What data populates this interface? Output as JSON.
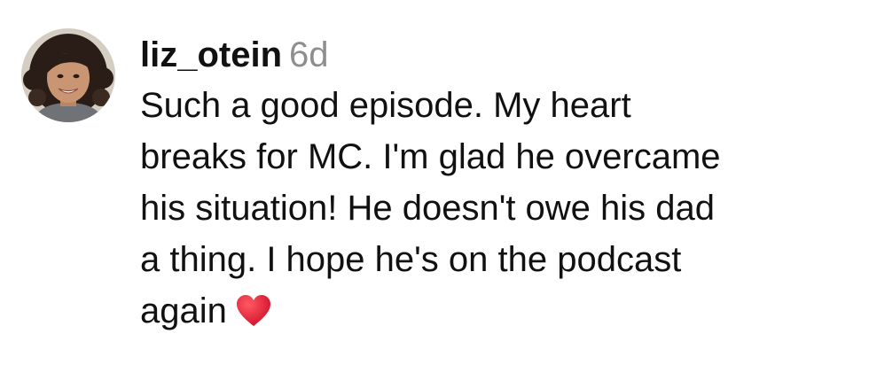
{
  "comment": {
    "username": "liz_otein",
    "timestamp": "6d",
    "lines": [
      "Such a good episode. My heart",
      "breaks for MC. I'm glad he overcame",
      "his situation! He doesn't owe his dad",
      "a thing. I hope he's on the podcast",
      "again"
    ],
    "emoji": "heart-icon",
    "heart_color": "#e8192c",
    "timestamp_color": "#8e8e8e"
  }
}
